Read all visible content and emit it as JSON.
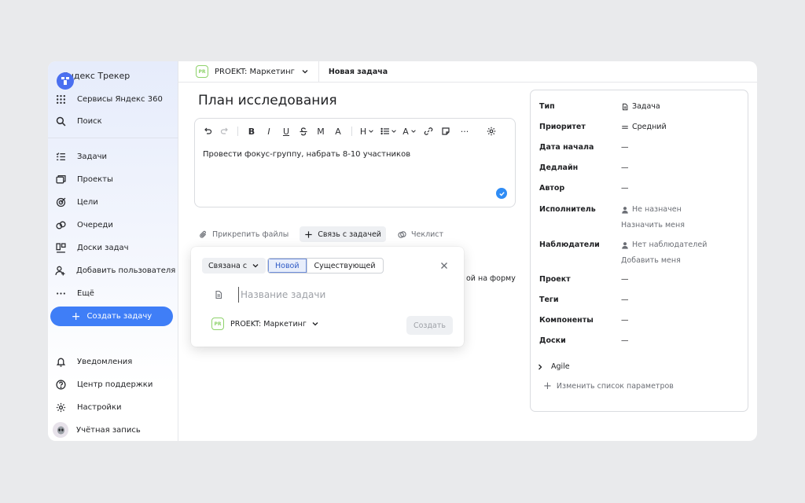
{
  "sidebar": {
    "app_name": "Яндекс Трекер",
    "top_items": [
      {
        "label": "Сервисы Яндекс 360",
        "icon": "grid-icon"
      },
      {
        "label": "Поиск",
        "icon": "search-icon"
      }
    ],
    "nav_items": [
      {
        "label": "Задачи",
        "icon": "tasks-icon"
      },
      {
        "label": "Проекты",
        "icon": "projects-icon"
      },
      {
        "label": "Цели",
        "icon": "goals-icon"
      },
      {
        "label": "Очереди",
        "icon": "queues-icon"
      },
      {
        "label": "Доски задач",
        "icon": "boards-icon"
      },
      {
        "label": "Добавить пользователя",
        "icon": "add-user-icon"
      },
      {
        "label": "Ещё",
        "icon": "more-icon"
      }
    ],
    "create_button": "Создать задачу",
    "bottom_items": [
      {
        "label": "Уведомления",
        "icon": "bell-icon"
      },
      {
        "label": "Центр поддержки",
        "icon": "help-icon"
      },
      {
        "label": "Настройки",
        "icon": "gear-icon"
      },
      {
        "label": "Учётная запись",
        "icon": "avatar"
      }
    ],
    "accent": "#3f7ef7"
  },
  "topbar": {
    "project_badge": "PR",
    "project_name": "PROEKT: Маркетинг",
    "tab_label": "Новая задача"
  },
  "task": {
    "title": "План исследования",
    "description": "Провести фокус-группу, набрать 8-10 участников",
    "toolbar": {
      "bold": "B",
      "italic": "I",
      "underline": "U",
      "monospace": "M",
      "font_size": "A",
      "heading": "H",
      "color": "A",
      "more": "···"
    }
  },
  "actions": {
    "attach": "Прикрепить файлы",
    "link": "Связь с задачей",
    "checklist": "Чеклист"
  },
  "hidden_text": "ой на форму",
  "link_popup": {
    "relation": "Связана с",
    "mode_new": "Новой",
    "mode_existing": "Существующей",
    "input_placeholder": "Название задачи",
    "project_badge": "PR",
    "project_name": "PROEKT: Маркетинг",
    "create_button": "Создать"
  },
  "properties": {
    "rows": [
      {
        "key": "Тип",
        "value": "Задача"
      },
      {
        "key": "Приоритет",
        "value": "Средний"
      },
      {
        "key": "Дата начала",
        "value": "—"
      },
      {
        "key": "Дедлайн",
        "value": "—"
      },
      {
        "key": "Автор",
        "value": "—"
      },
      {
        "key": "Исполнитель",
        "value": "Не назначен",
        "sub": "Назначить меня"
      },
      {
        "key": "Наблюдатели",
        "value": "Нет наблюдателей",
        "sub": "Добавить меня"
      },
      {
        "key": "Проект",
        "value": "—"
      },
      {
        "key": "Теги",
        "value": "—"
      },
      {
        "key": "Компоненты",
        "value": "—"
      },
      {
        "key": "Доски",
        "value": "—"
      }
    ],
    "agile": "Agile",
    "edit_params": "Изменить список параметров"
  }
}
